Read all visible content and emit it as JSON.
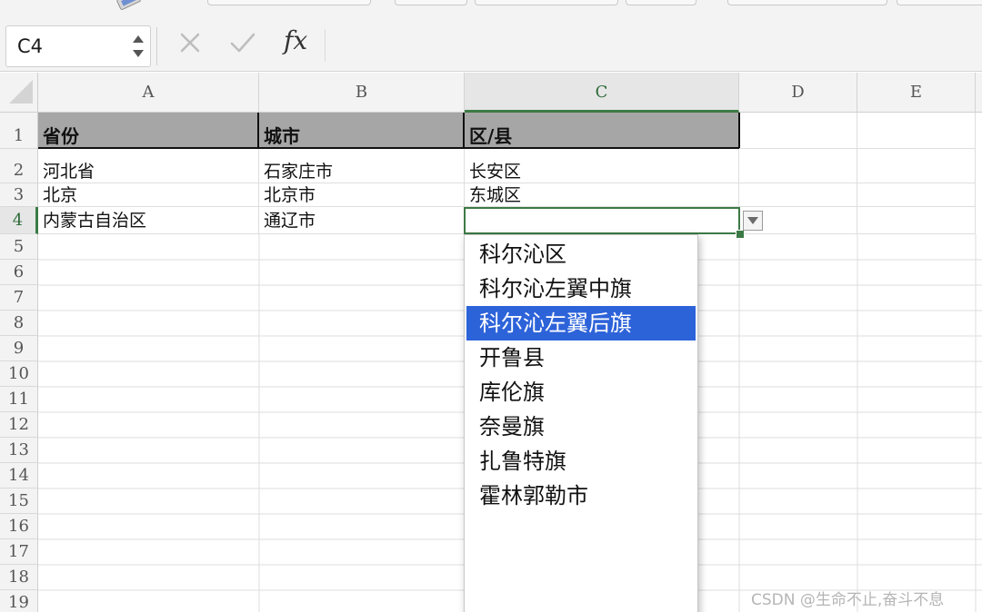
{
  "formula_bar": {
    "name_box": "C4",
    "fx_label": "fx",
    "formula": ""
  },
  "sheet": {
    "columns": [
      "A",
      "B",
      "C",
      "D",
      "E"
    ],
    "rows": [
      "1",
      "2",
      "3",
      "4",
      "5",
      "6",
      "7",
      "8",
      "9",
      "10",
      "11",
      "12",
      "13",
      "14",
      "15",
      "16",
      "17",
      "18",
      "19"
    ],
    "active_cell": "C4",
    "cells": {
      "A1": "省份",
      "B1": "城市",
      "C1": "区/县",
      "A2": "河北省",
      "B2": "石家庄市",
      "C2": "长安区",
      "A3": "北京",
      "B3": "北京市",
      "C3": "东城区",
      "A4": "内蒙古自治区",
      "B4": "通辽市",
      "C4": ""
    },
    "header_fill": "#a6a6a6",
    "selection_color": "#3c7a45"
  },
  "validation_list": {
    "items": [
      "科尔沁区",
      "科尔沁左翼中旗",
      "科尔沁左翼后旗",
      "开鲁县",
      "库伦旗",
      "奈曼旗",
      "扎鲁特旗",
      "霍林郭勒市"
    ],
    "selected_index": 2,
    "highlight_color": "#2d63d9"
  },
  "watermark": "CSDN @生命不止,奋斗不息"
}
